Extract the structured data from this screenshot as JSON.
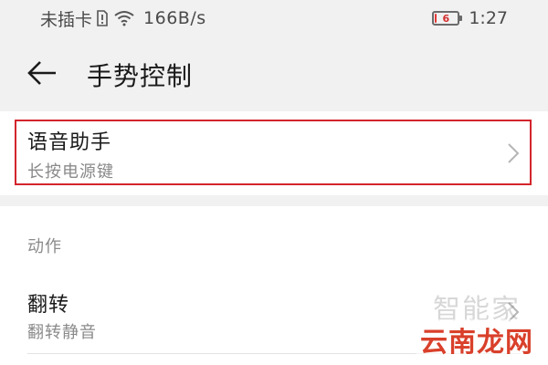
{
  "status_bar": {
    "carrier": "未插卡",
    "speed": "166B/s",
    "battery_level": "6",
    "battery_fraction": 0.06,
    "time": "1:27"
  },
  "app_bar": {
    "title": "手势控制"
  },
  "voice_assistant": {
    "title": "语音助手",
    "subtitle": "长按电源键",
    "highlight_color": "#d3252c"
  },
  "actions": {
    "section_title": "动作",
    "items": [
      {
        "title": "翻转",
        "subtitle": "翻转静音"
      }
    ]
  },
  "watermark": {
    "top": "智能家",
    "bottom": "云南龙网"
  },
  "colors": {
    "background": "#f1f1f1",
    "card": "#ffffff",
    "accent_red": "#d3252c"
  },
  "icons": {
    "back": "arrow-left-icon",
    "chevron": "chevron-right-icon",
    "wifi": "wifi-icon",
    "sim": "no-sim-icon",
    "battery": "battery-icon"
  }
}
